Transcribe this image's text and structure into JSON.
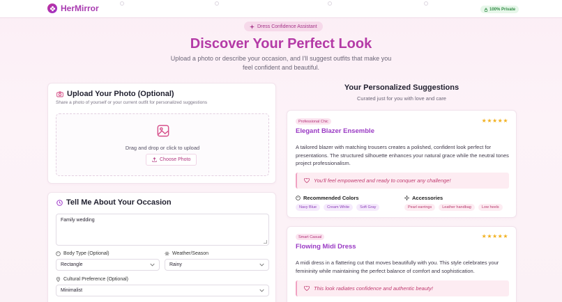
{
  "header": {
    "brand": "HerMirror",
    "private_badge": "100% Private"
  },
  "hero": {
    "pill": "Dress Confidence Assistant",
    "title": "Discover Your Perfect Look",
    "subtitle": "Upload a photo or describe your occasion, and I'll suggest outfits that make you feel confident and beautiful."
  },
  "upload": {
    "title": "Upload Your Photo (Optional)",
    "subtitle": "Share a photo of yourself or your current outfit for personalized suggestions",
    "drop_text": "Drag and drop or click to upload",
    "button": "Choose Photo"
  },
  "occasion": {
    "title": "Tell Me About Your Occasion",
    "description_value": "Family wedding",
    "body_type_label": "Body Type (Optional)",
    "body_type_value": "Rectangle",
    "weather_label": "Weather/Season",
    "weather_value": "Rainy",
    "cultural_label": "Cultural Preference (Optional)",
    "cultural_value": "Minimalist"
  },
  "suggestions": {
    "title": "Your Personalized Suggestions",
    "subtitle": "Curated just for you with love and care",
    "stars": "★★★★★",
    "items": [
      {
        "tag": "Professional Chic",
        "title": "Elegant Blazer Ensemble",
        "description": "A tailored blazer with matching trousers creates a polished, confident look perfect for presentations. The structured silhouette enhances your natural grace while the neutral tones project professionalism.",
        "quote": "You'll feel empowered and ready to conquer any challenge!",
        "colors_label": "Recommended Colors",
        "colors": [
          "Navy Blue",
          "Cream White",
          "Soft Gray"
        ],
        "accessories_label": "Accessories",
        "accessories": [
          "Pearl earrings",
          "Leather handbag",
          "Low heels"
        ]
      },
      {
        "tag": "Smart Casual",
        "title": "Flowing Midi Dress",
        "description": "A midi dress in a flattering cut that moves beautifully with you. This style celebrates your femininity while maintaining the perfect balance of comfort and sophistication.",
        "quote": "This look radiates confidence and authentic beauty!"
      }
    ]
  },
  "colors": {
    "brand": "#b43aa6",
    "accent_pink": "#c03a6f",
    "star": "#f2b01e"
  }
}
